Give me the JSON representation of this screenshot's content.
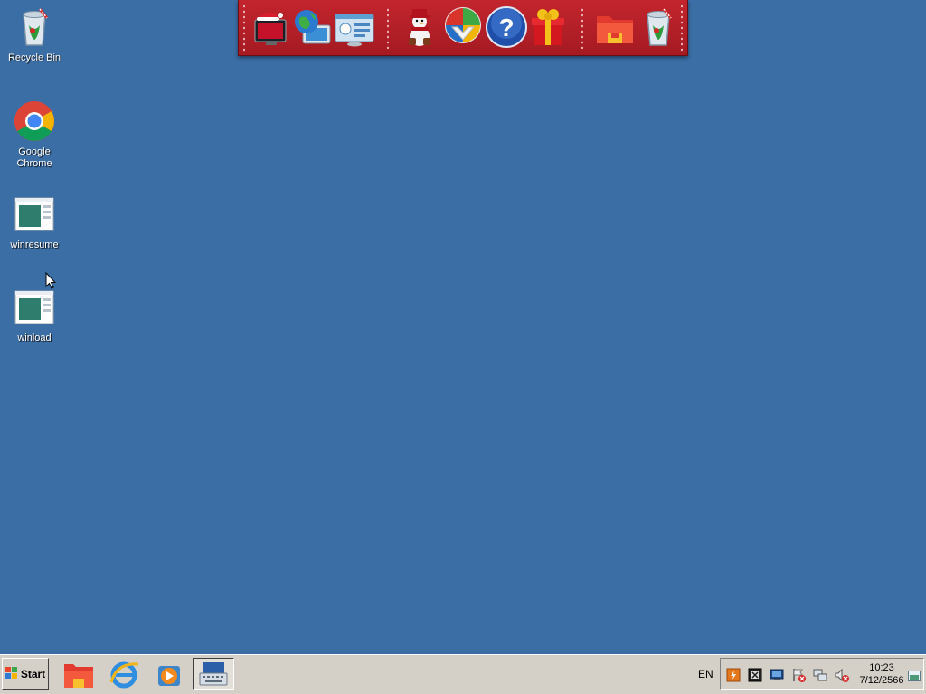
{
  "desktop": {
    "background": "#3b6ea5",
    "icons": [
      {
        "label": "Recycle Bin",
        "icon": "recycle-bin-icon"
      },
      {
        "label": "Google Chrome",
        "icon": "chrome-icon"
      },
      {
        "label": "winresume",
        "icon": "application-window-icon"
      },
      {
        "label": "winload",
        "icon": "application-window-icon"
      }
    ]
  },
  "dock": {
    "theme_color": "#b8212a",
    "items": [
      "christmas-monitor-icon",
      "globe-network-icon",
      "control-panel-icon",
      "snowman-icon",
      "windows-shield-icon",
      "help-icon",
      "gift-box-icon",
      "folder-icon",
      "recycle-bin-icon"
    ]
  },
  "taskbar": {
    "start_label": "Start",
    "buttons": [
      "file-explorer-icon",
      "internet-explorer-icon",
      "media-player-icon",
      "on-screen-keyboard-icon"
    ],
    "tray": {
      "language": "EN",
      "icons": [
        "flash-icon",
        "tool-icon",
        "display-icon",
        "action-center-icon",
        "network-icon",
        "volume-muted-icon"
      ],
      "time": "10:23",
      "date": "7/12/2566"
    }
  }
}
